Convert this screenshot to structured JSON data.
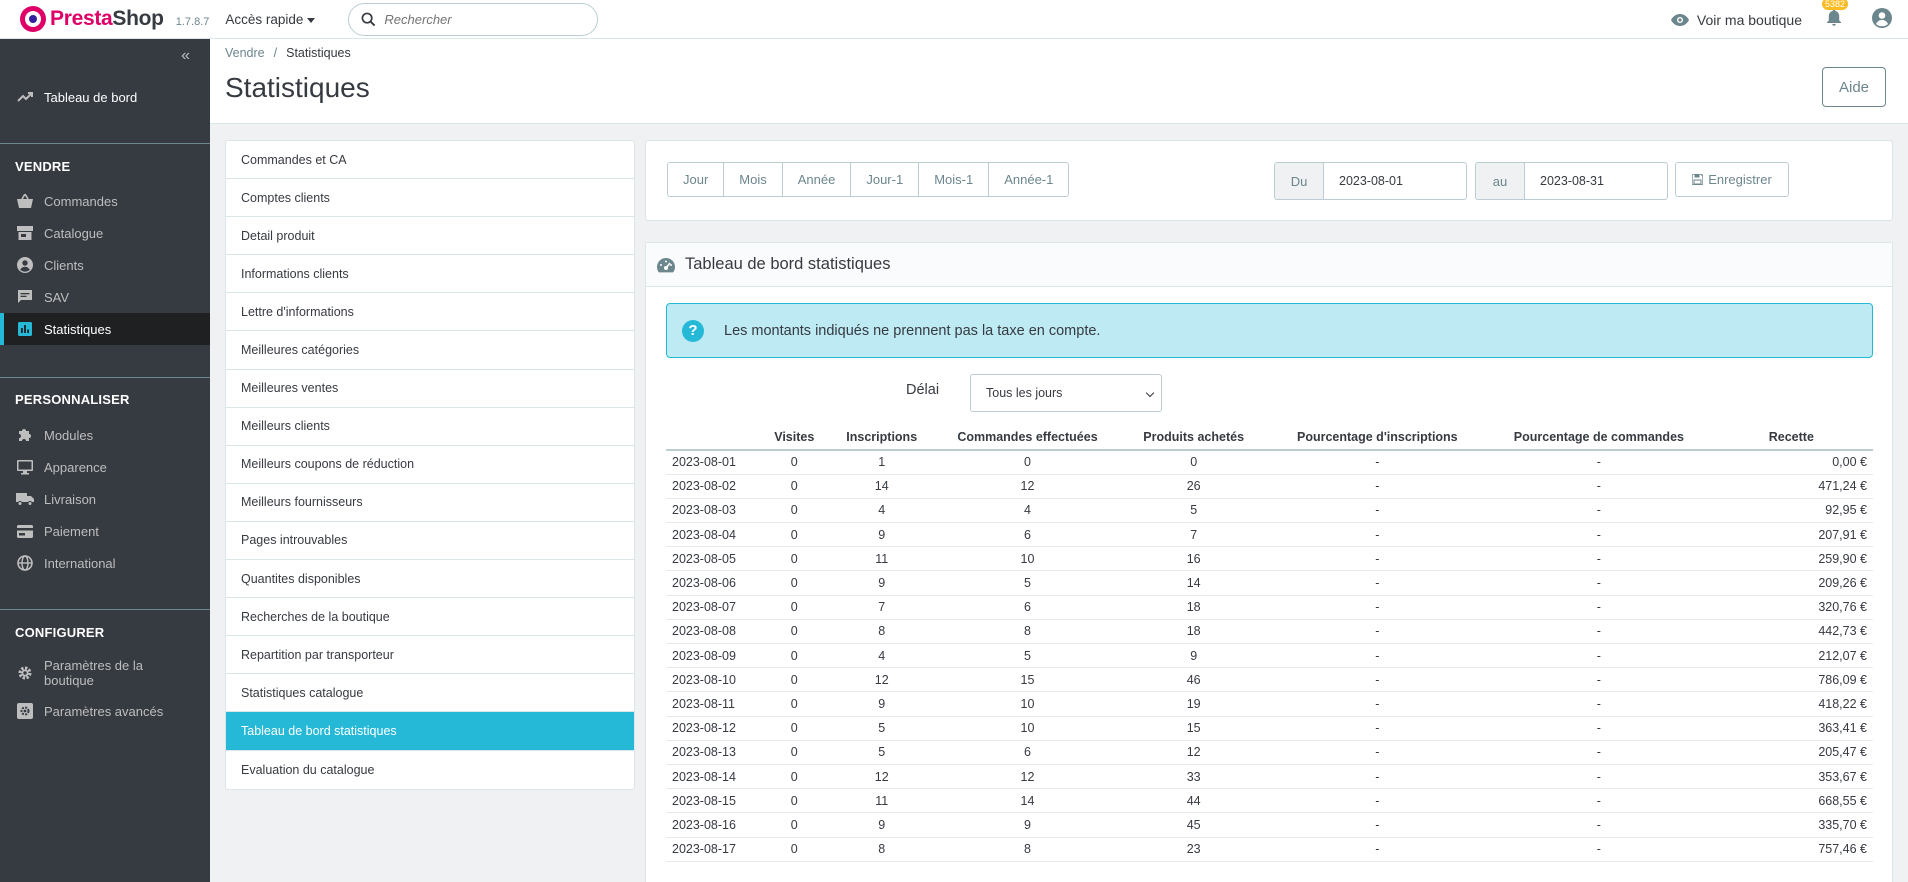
{
  "header": {
    "brand_pre": "Presta",
    "brand_post": "Shop",
    "version": "1.7.8.7",
    "quick_access": "Accès rapide",
    "search_placeholder": "Rechercher",
    "view_shop": "Voir ma boutique",
    "notifications_count": "5382"
  },
  "sidebar": {
    "dashboard": "Tableau de bord",
    "sections": [
      {
        "title": "VENDRE",
        "items": [
          "Commandes",
          "Catalogue",
          "Clients",
          "SAV",
          "Statistiques"
        ]
      },
      {
        "title": "PERSONNALISER",
        "items": [
          "Modules",
          "Apparence",
          "Livraison",
          "Paiement",
          "International"
        ]
      },
      {
        "title": "CONFIGURER",
        "items": [
          "Paramètres de la boutique",
          "Paramètres avancés"
        ]
      }
    ],
    "active_item": "Statistiques"
  },
  "page": {
    "breadcrumb": [
      "Vendre",
      "Statistiques"
    ],
    "title": "Statistiques",
    "help_button": "Aide"
  },
  "modules": [
    "Commandes et CA",
    "Comptes clients",
    "Detail produit",
    "Informations clients",
    "Lettre d'informations",
    "Meilleures catégories",
    "Meilleures ventes",
    "Meilleurs clients",
    "Meilleurs coupons de réduction",
    "Meilleurs fournisseurs",
    "Pages introuvables",
    "Quantites disponibles",
    "Recherches de la boutique",
    "Repartition par transporteur",
    "Statistiques catalogue",
    "Tableau de bord statistiques",
    "Evaluation du catalogue"
  ],
  "active_module": "Tableau de bord statistiques",
  "range": {
    "buttons": [
      "Jour",
      "Mois",
      "Année",
      "Jour-1",
      "Mois-1",
      "Année-1"
    ],
    "from_label": "Du",
    "from_value": "2023-08-01",
    "to_label": "au",
    "to_value": "2023-08-31",
    "save_button": "Enregistrer"
  },
  "stats": {
    "title": "Tableau de bord statistiques",
    "alert": "Les montants indiqués ne prennent pas la taxe en compte.",
    "delay_label": "Délai",
    "delay_value": "Tous les jours",
    "columns": [
      "",
      "Visites",
      "Inscriptions",
      "Commandes effectuées",
      "Produits achetés",
      "Pourcentage d'inscriptions",
      "Pourcentage de commandes",
      "Recette"
    ],
    "rows": [
      [
        "2023-08-01",
        "0",
        "1",
        "0",
        "0",
        "-",
        "-",
        "0,00 €"
      ],
      [
        "2023-08-02",
        "0",
        "14",
        "12",
        "26",
        "-",
        "-",
        "471,24 €"
      ],
      [
        "2023-08-03",
        "0",
        "4",
        "4",
        "5",
        "-",
        "-",
        "92,95 €"
      ],
      [
        "2023-08-04",
        "0",
        "9",
        "6",
        "7",
        "-",
        "-",
        "207,91 €"
      ],
      [
        "2023-08-05",
        "0",
        "11",
        "10",
        "16",
        "-",
        "-",
        "259,90 €"
      ],
      [
        "2023-08-06",
        "0",
        "9",
        "5",
        "14",
        "-",
        "-",
        "209,26 €"
      ],
      [
        "2023-08-07",
        "0",
        "7",
        "6",
        "18",
        "-",
        "-",
        "320,76 €"
      ],
      [
        "2023-08-08",
        "0",
        "8",
        "8",
        "18",
        "-",
        "-",
        "442,73 €"
      ],
      [
        "2023-08-09",
        "0",
        "4",
        "5",
        "9",
        "-",
        "-",
        "212,07 €"
      ],
      [
        "2023-08-10",
        "0",
        "12",
        "15",
        "46",
        "-",
        "-",
        "786,09 €"
      ],
      [
        "2023-08-11",
        "0",
        "9",
        "10",
        "19",
        "-",
        "-",
        "418,22 €"
      ],
      [
        "2023-08-12",
        "0",
        "5",
        "10",
        "15",
        "-",
        "-",
        "363,41 €"
      ],
      [
        "2023-08-13",
        "0",
        "5",
        "6",
        "12",
        "-",
        "-",
        "205,47 €"
      ],
      [
        "2023-08-14",
        "0",
        "12",
        "12",
        "33",
        "-",
        "-",
        "353,67 €"
      ],
      [
        "2023-08-15",
        "0",
        "11",
        "14",
        "44",
        "-",
        "-",
        "668,55 €"
      ],
      [
        "2023-08-16",
        "0",
        "9",
        "9",
        "45",
        "-",
        "-",
        "335,70 €"
      ],
      [
        "2023-08-17",
        "0",
        "8",
        "8",
        "23",
        "-",
        "-",
        "757,46 €"
      ]
    ]
  }
}
